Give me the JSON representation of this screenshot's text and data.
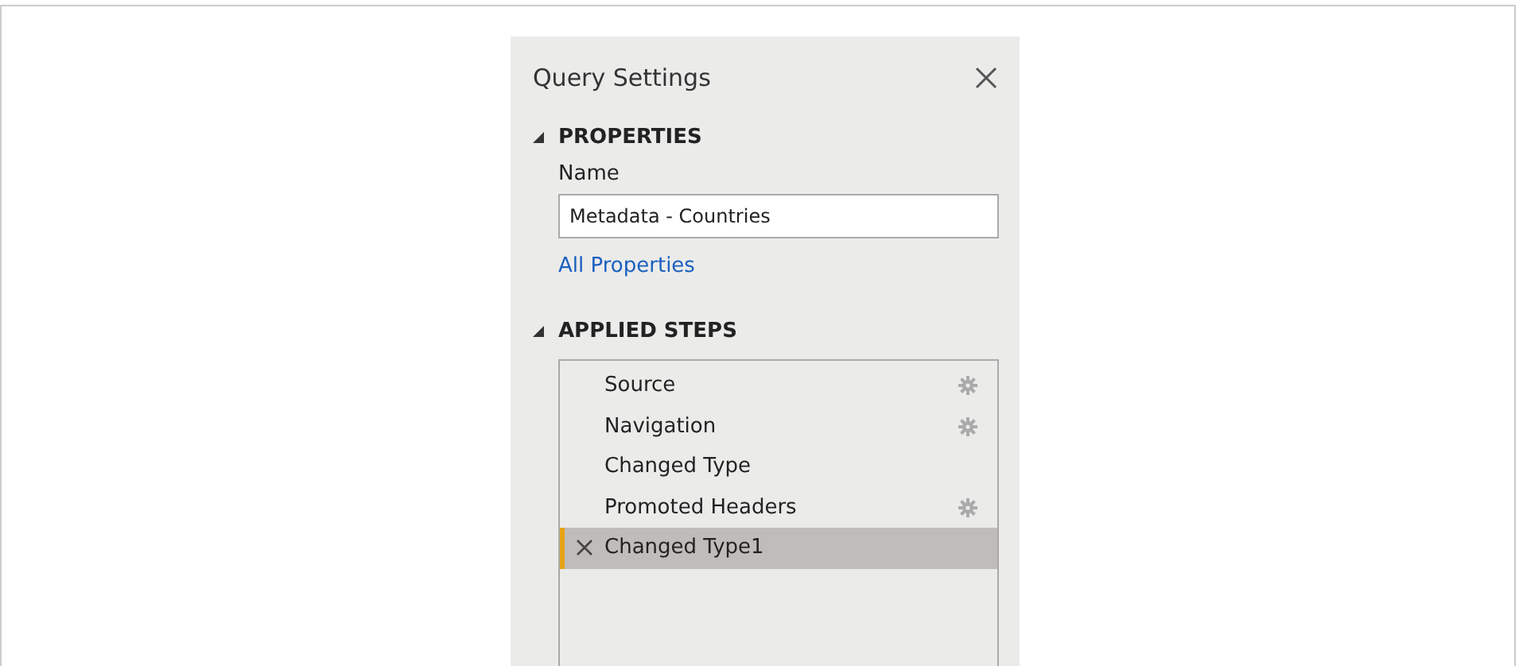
{
  "panel": {
    "title": "Query Settings"
  },
  "properties": {
    "heading": "PROPERTIES",
    "expanded": true,
    "name_label": "Name",
    "name_value": "Metadata - Countries",
    "link": "All Properties"
  },
  "applied_steps": {
    "heading": "APPLIED STEPS",
    "expanded": true,
    "steps": [
      {
        "label": "Source",
        "has_settings": true,
        "selected": false
      },
      {
        "label": "Navigation",
        "has_settings": true,
        "selected": false
      },
      {
        "label": "Changed Type",
        "has_settings": false,
        "selected": false
      },
      {
        "label": "Promoted Headers",
        "has_settings": true,
        "selected": false
      },
      {
        "label": "Changed Type1",
        "has_settings": false,
        "selected": true
      }
    ]
  }
}
